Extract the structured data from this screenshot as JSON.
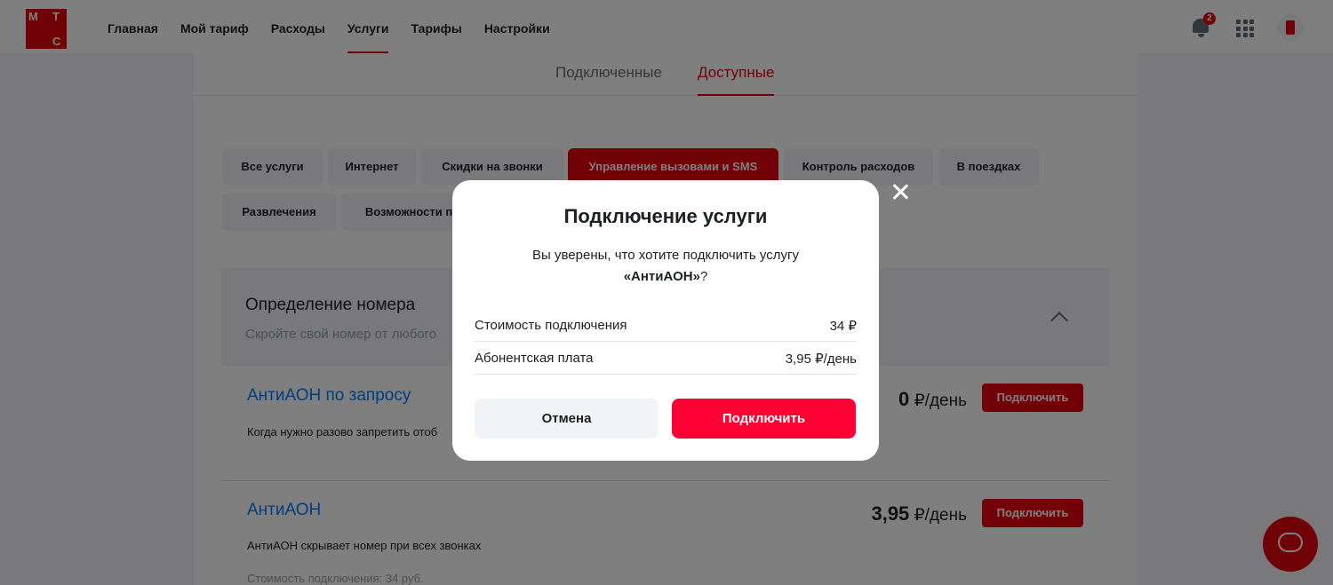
{
  "header": {
    "logo": [
      "М",
      "Т",
      "С"
    ],
    "nav": [
      "Главная",
      "Мой тариф",
      "Расходы",
      "Услуги",
      "Тарифы",
      "Настройки"
    ],
    "active_nav": "Услуги",
    "notifications_badge": "2"
  },
  "tabs": {
    "connected": "Подключенные",
    "available": "Доступные",
    "active": "Доступные"
  },
  "chips": [
    "Все услуги",
    "Интернет",
    "Скидки на звонки",
    "Управление вызовами и SMS",
    "Контроль расходов",
    "В поездках",
    "Развлечения",
    "Возможности пр"
  ],
  "active_chip": "Управление вызовами и SMS",
  "group": {
    "title": "Определение номера",
    "subtitle": "Скройте свой номер от любого"
  },
  "services": [
    {
      "title": "АнтиАОН по запросу",
      "desc": "Когда нужно разово запретить отоб",
      "price_value": "0",
      "price_unit": "₽/день",
      "button": "Подключить"
    },
    {
      "title": "АнтиАОН",
      "desc": "АнтиАОН скрывает номер при всех звонках",
      "extra": "Стоимость подключения: 34 руб.",
      "price_value": "3,95",
      "price_unit": "₽/день",
      "button": "Подключить"
    }
  ],
  "modal": {
    "title": "Подключение услуги",
    "question_prefix": "Вы уверены, что хотите подключить услугу",
    "service_name": "«АнтиАОН»",
    "question_suffix": "?",
    "rows": [
      {
        "label": "Стоимость подключения",
        "value": "34 ₽"
      },
      {
        "label": "Абонентская плата",
        "value": "3,95 ₽/день"
      }
    ],
    "cancel": "Отмена",
    "confirm": "Подключить"
  },
  "colors": {
    "brand": "#e30611",
    "confirm": "#ff0032",
    "link": "#007cff"
  }
}
